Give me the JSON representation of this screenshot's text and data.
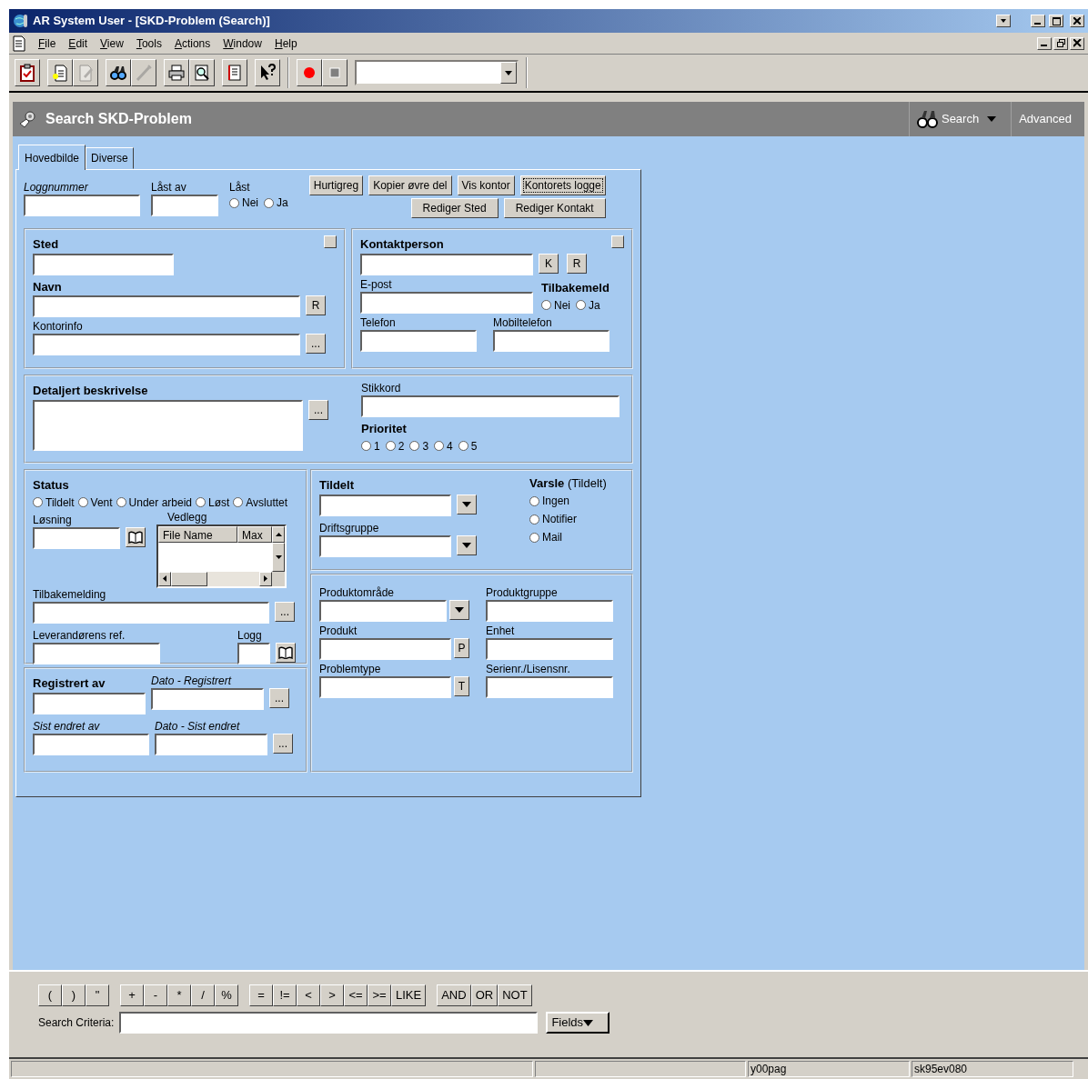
{
  "window": {
    "title": "AR System User - [SKD-Problem (Search)]"
  },
  "menu": [
    "File",
    "Edit",
    "View",
    "Tools",
    "Actions",
    "Window",
    "Help"
  ],
  "toolbar": {
    "groups": [
      [
        {
          "kind": "clipboard",
          "disabled": false
        }
      ],
      [
        {
          "kind": "new-doc",
          "disabled": false
        },
        {
          "kind": "edit-doc",
          "disabled": true
        }
      ],
      [
        {
          "kind": "binoculars",
          "disabled": false
        },
        {
          "kind": "wand",
          "disabled": true
        }
      ],
      [
        {
          "kind": "printer",
          "disabled": false
        },
        {
          "kind": "preview",
          "disabled": false
        }
      ],
      [
        {
          "kind": "report",
          "disabled": false
        }
      ],
      [
        {
          "kind": "help-pointer",
          "disabled": false
        }
      ],
      [
        {
          "kind": "record",
          "disabled": false
        },
        {
          "kind": "stop",
          "disabled": false
        }
      ]
    ]
  },
  "form_header": {
    "title": "Search SKD-Problem",
    "search": "Search",
    "advanced": "Advanced"
  },
  "tabs": [
    {
      "label": "Hovedbilde",
      "selected": true
    },
    {
      "label": "Diverse",
      "selected": false
    }
  ],
  "top": {
    "loggnummer": {
      "label": "Loggnummer",
      "italic": true
    },
    "last_av": {
      "label": "Låst av"
    },
    "last": {
      "label": "Låst",
      "options": [
        {
          "label": "Nei",
          "selected": false
        },
        {
          "label": "Ja",
          "selected": false
        }
      ]
    },
    "buttons": [
      [
        {
          "label": "Hurtigreg",
          "focused": false
        },
        {
          "label": "Kopier øvre del",
          "focused": false
        },
        {
          "label": "Vis kontor",
          "focused": false
        },
        {
          "label": "Kontorets logge",
          "focused": true
        }
      ],
      [
        {
          "label": "Rediger Sted",
          "focused": false
        },
        {
          "label": "Rediger Kontakt",
          "focused": false
        }
      ]
    ]
  },
  "sted": {
    "title": "Sted",
    "navn": {
      "label": "Navn",
      "button": "R"
    },
    "kontorinfo": {
      "label": "Kontorinfo",
      "button": "..."
    }
  },
  "kontakt": {
    "title": "Kontaktperson",
    "buttons": [
      "K",
      "R"
    ],
    "epost": {
      "label": "E-post"
    },
    "tilbakemeld": {
      "label": "Tilbakemeld",
      "options": [
        {
          "label": "Nei",
          "selected": false
        },
        {
          "label": "Ja",
          "selected": false
        }
      ]
    },
    "telefon": {
      "label": "Telefon"
    },
    "mobil": {
      "label": "Mobiltelefon"
    }
  },
  "beskrivelse": {
    "title": "Detaljert beskrivelse",
    "button": "...",
    "stikkord": {
      "label": "Stikkord"
    },
    "prioritet": {
      "label": "Prioritet",
      "options": [
        {
          "label": "1",
          "selected": false
        },
        {
          "label": "2",
          "selected": false
        },
        {
          "label": "3",
          "selected": false
        },
        {
          "label": "4",
          "selected": false
        },
        {
          "label": "5",
          "selected": false
        }
      ]
    }
  },
  "status": {
    "title": "Status",
    "options": [
      {
        "label": "Tildelt",
        "selected": false
      },
      {
        "label": "Vent",
        "selected": false
      },
      {
        "label": "Under arbeid",
        "selected": false
      },
      {
        "label": "Løst",
        "selected": false
      },
      {
        "label": "Avsluttet",
        "selected": false
      }
    ],
    "losning": {
      "label": "Løsning"
    },
    "vedlegg": {
      "label": "Vedlegg",
      "columns": [
        "File Name",
        "Max"
      ]
    },
    "tilbakemelding": {
      "label": "Tilbakemelding",
      "button": "..."
    },
    "leverandor": {
      "label": "Leverandørens ref."
    },
    "logg": {
      "label": "Logg"
    }
  },
  "registrert": {
    "registrert_av": {
      "label": "Registrert av"
    },
    "dato_registrert": {
      "label": "Dato - Registrert",
      "italic": true,
      "button": "..."
    },
    "sist_endret_av": {
      "label": "Sist endret av",
      "italic": true
    },
    "dato_sist_endret": {
      "label": "Dato - Sist endret",
      "italic": true,
      "button": "..."
    }
  },
  "tildelt": {
    "title": "Tildelt",
    "driftsgruppe": {
      "label": "Driftsgruppe"
    },
    "varsle": {
      "label": "**Varsle** (Tildelt)",
      "options": [
        {
          "label": "Ingen",
          "selected": false
        },
        {
          "label": "Notifier",
          "selected": false
        },
        {
          "label": "Mail",
          "selected": false
        }
      ]
    }
  },
  "produkt": {
    "produktomrade": {
      "label": "Produktområde"
    },
    "produktgruppe": {
      "label": "Produktgruppe"
    },
    "produkt": {
      "label": "Produkt",
      "button": "P"
    },
    "enhet": {
      "label": "Enhet"
    },
    "problemtype": {
      "label": "Problemtype",
      "button": "T"
    },
    "serienr": {
      "label": "Serienr./Lisensnr."
    }
  },
  "query_bar": {
    "operator_groups": [
      [
        "(",
        ")",
        "\""
      ],
      [
        "+",
        "-",
        "*",
        "/",
        "%"
      ],
      [
        "=",
        "!=",
        "<",
        ">",
        "<=",
        ">=",
        "LIKE"
      ],
      [
        "AND",
        "OR",
        "NOT"
      ]
    ],
    "search_criteria": {
      "label": "Search Criteria:"
    },
    "fields_button": "Fields"
  },
  "status_bar": {
    "cells": [
      "y00pag",
      "sk95ev080"
    ]
  }
}
